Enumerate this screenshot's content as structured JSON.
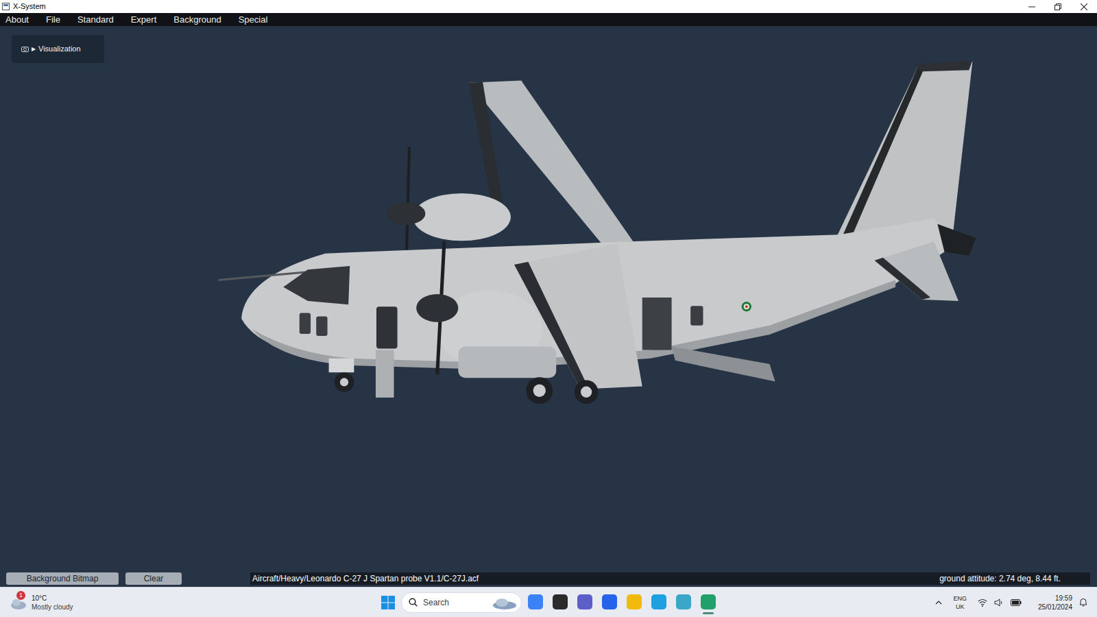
{
  "window": {
    "title": "X-System"
  },
  "menu": [
    "About",
    "File",
    "Standard",
    "Expert",
    "Background",
    "Special"
  ],
  "visualization_panel": {
    "arrow": "▶",
    "label": "Visualization",
    "expanded": false
  },
  "bottom_bar": {
    "buttons": [
      "Background Bitmap",
      "Clear"
    ],
    "file_path": "Aircraft/Heavy/Leonardo C-27 J Spartan probe V1.1/C-27J.acf",
    "ground_attitude": "ground attitude: 2.74 deg, 8.44 ft."
  },
  "taskbar": {
    "weather": {
      "temperature": "10°C",
      "condition": "Mostly cloudy",
      "badge": "1"
    },
    "search": {
      "placeholder": "Search"
    },
    "apps": [
      {
        "color": "#3b82f6",
        "running": false
      },
      {
        "color": "#2b2b2b",
        "running": false
      },
      {
        "color": "#5b5fc7",
        "running": false
      },
      {
        "color": "#2563eb",
        "running": false
      },
      {
        "color": "#f2b90f",
        "running": false
      },
      {
        "color": "#1fa0e0",
        "running": false
      },
      {
        "color": "#3aa7c9",
        "running": false
      },
      {
        "color": "#22a06b",
        "running": true
      }
    ],
    "tray": {
      "language": "ENG",
      "region": "UK",
      "time": "19:59",
      "date": "25/01/2024"
    }
  }
}
